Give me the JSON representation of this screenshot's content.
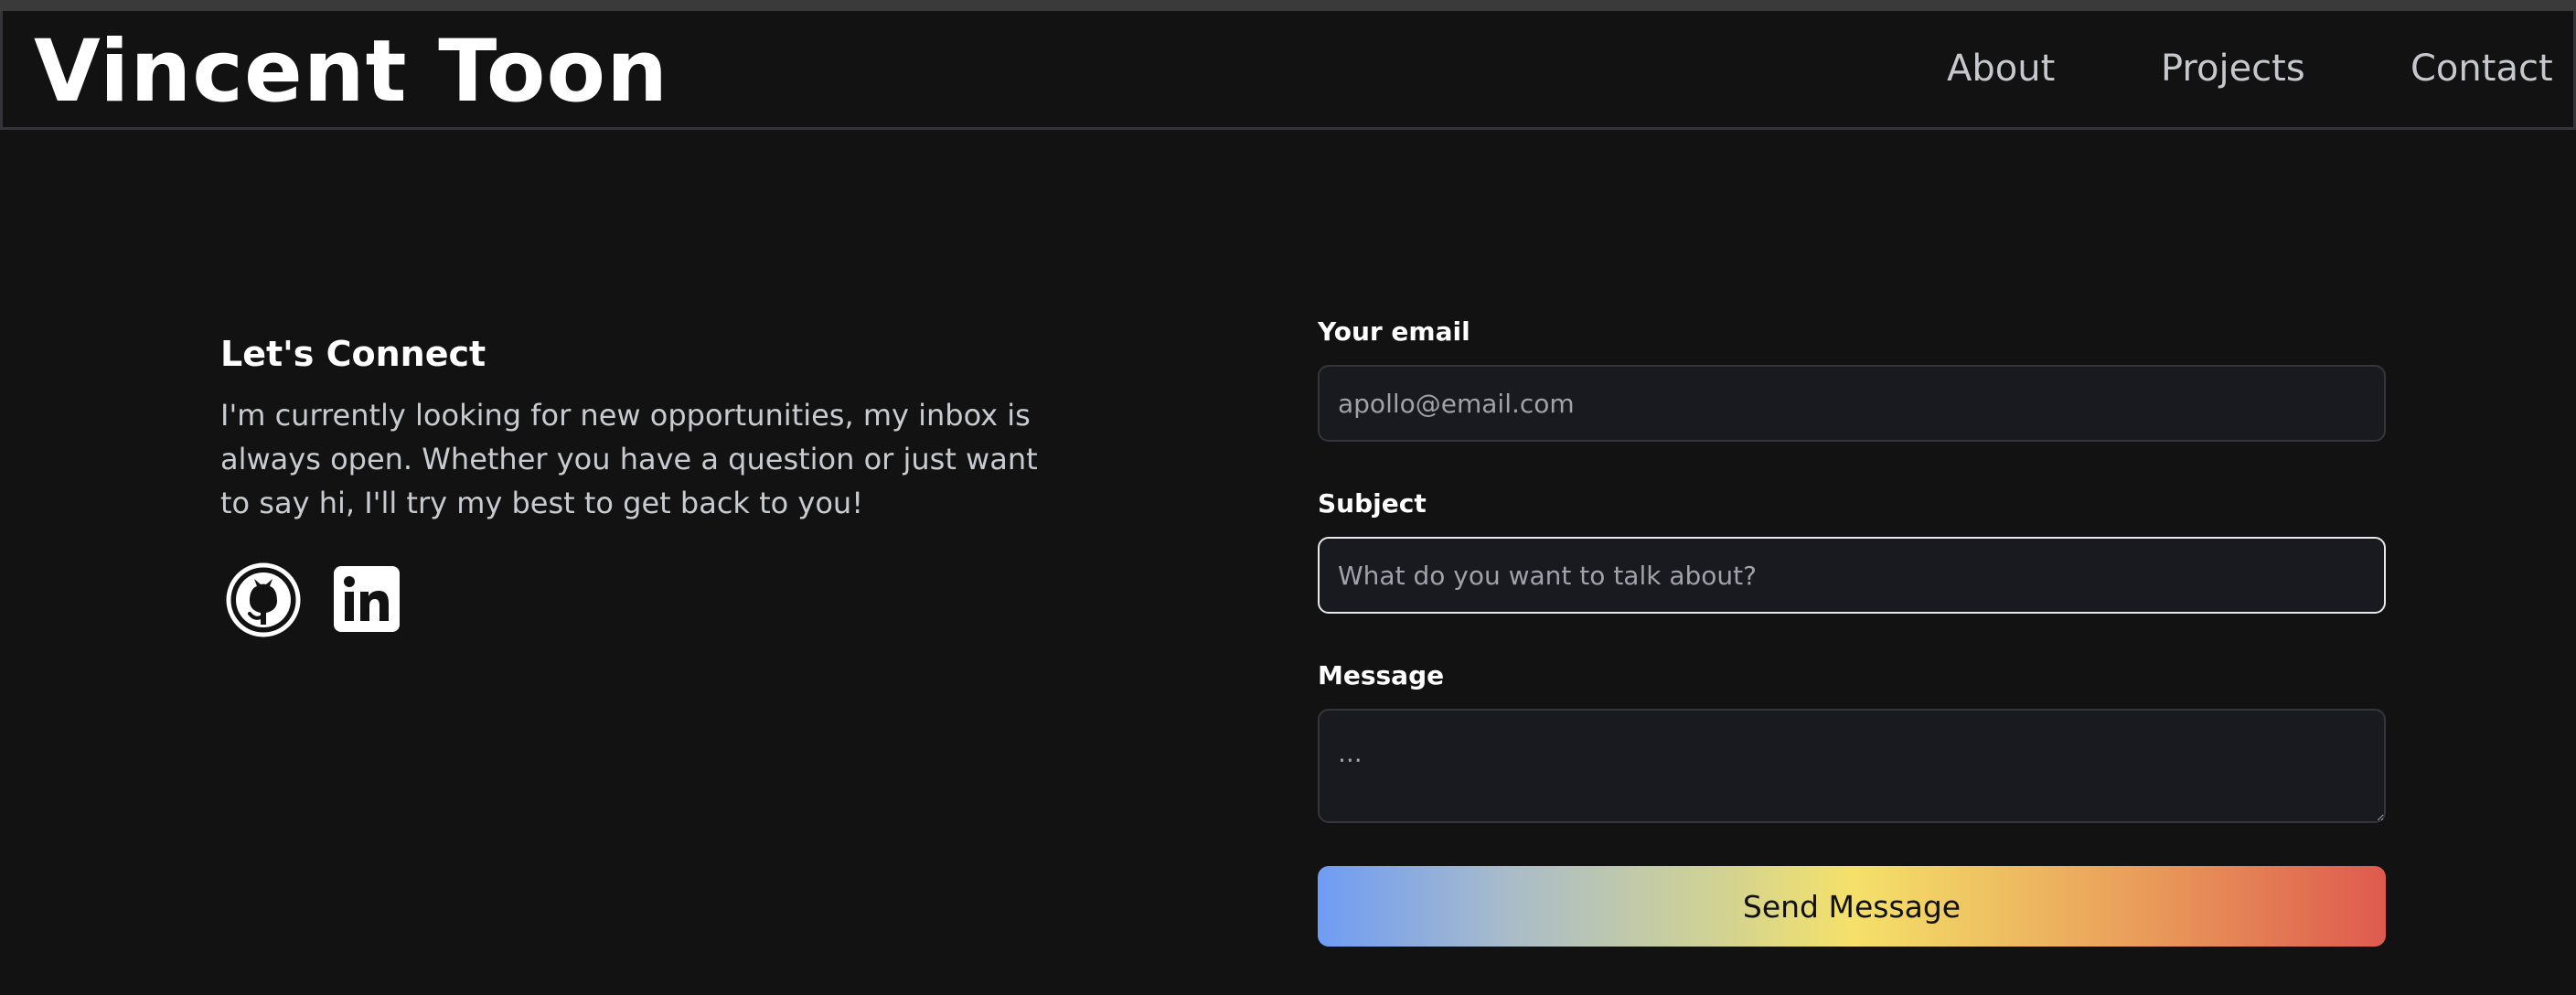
{
  "header": {
    "logo_text": "Vincent Toon",
    "nav": [
      {
        "label": "About"
      },
      {
        "label": "Projects"
      },
      {
        "label": "Contact"
      }
    ]
  },
  "connect": {
    "title": "Let's Connect",
    "text": "I'm currently looking for new opportunities, my inbox is always open. Whether you have a question or just want to say hi, I'll try my best to get back to you!",
    "social_icons": [
      "github-icon",
      "linkedin-icon"
    ]
  },
  "form": {
    "email_label": "Your email",
    "email_placeholder": "apollo@email.com",
    "subject_label": "Subject",
    "subject_placeholder": "What do you want to talk about?",
    "message_label": "Message",
    "message_placeholder": "...",
    "submit_label": "Send Message"
  },
  "colors": {
    "background": "#121212",
    "field_background": "#191a1f",
    "button_gradient": [
      "#6f9cf4",
      "#f5e16a",
      "#de5a4e"
    ]
  }
}
